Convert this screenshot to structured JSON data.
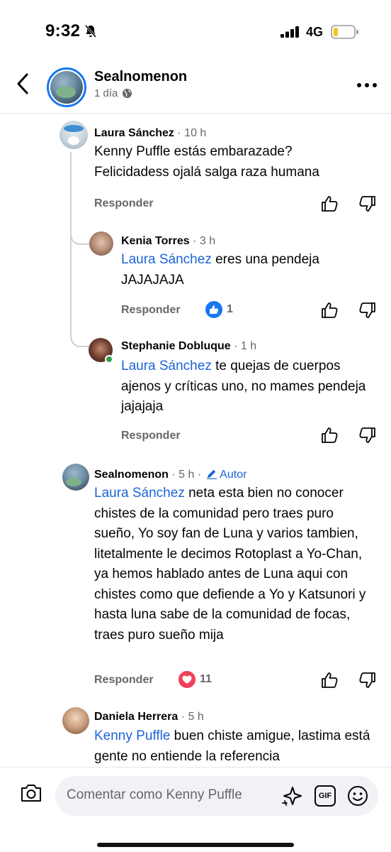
{
  "status_bar": {
    "time": "9:32",
    "network": "4G"
  },
  "header": {
    "page_name": "Sealnomenon",
    "post_time": "1 día"
  },
  "comments": [
    {
      "author": "Laura Sánchez",
      "time": "· 10 h",
      "text": "Kenny Puffle estás embarazade? Felicidadess ojalá salga raza humana",
      "reply_label": "Responder"
    },
    {
      "author": "Kenia Torres",
      "time": "· 3 h",
      "mention": "Laura Sánchez",
      "text": " eres una pendeja JAJAJAJA",
      "reply_label": "Responder",
      "reaction_count": "1"
    },
    {
      "author": "Stephanie Dobluque",
      "time": "· 1 h",
      "mention": "Laura Sánchez",
      "text": " te quejas de cuerpos ajenos y críticas uno, no mames pendeja jajajaja",
      "reply_label": "Responder"
    },
    {
      "author": "Sealnomenon",
      "time": "· 5 h ·",
      "badge": "Autor",
      "mention": "Laura Sánchez",
      "text": " neta esta bien no conocer chistes de la comunidad pero traes puro sueño, Yo soy fan de Luna y varios tambien, litetalmente le decimos Rotoplast a Yo-Chan, ya hemos hablado antes de Luna aqui con chistes como que defiende a Yo y Katsunori y hasta luna sabe de la comunidad de focas, traes puro sueño mija",
      "reply_label": "Responder",
      "reaction_count": "11"
    },
    {
      "author": "Daniela Herrera",
      "time": "· 5 h",
      "mention": "Kenny Puffle",
      "text": " buen chiste amigue, lastima está gente no entiende la referencia"
    }
  ],
  "composer": {
    "placeholder": "Comentar como Kenny Puffle",
    "gif_label": "GIF"
  },
  "colors": {
    "accent": "#1877f2",
    "mention": "#1a65d6",
    "love": "#f33e58",
    "muted": "#65676b"
  }
}
